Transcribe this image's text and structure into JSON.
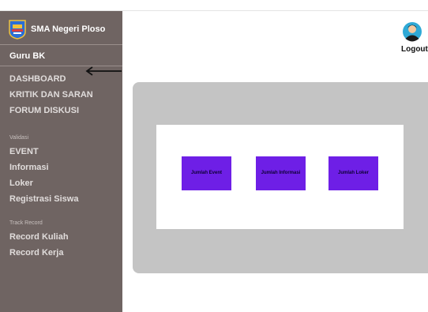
{
  "header": {
    "logout_label": "Logout"
  },
  "sidebar": {
    "school_name": "SMA Negeri Ploso",
    "role": "Guru BK",
    "main_items": [
      {
        "label": "DASHBOARD"
      },
      {
        "label": "KRITIK DAN SARAN"
      },
      {
        "label": "FORUM DISKUSI"
      }
    ],
    "validasi_label": "Validasi",
    "validasi_items": [
      {
        "label": "EVENT"
      },
      {
        "label": "Informasi"
      },
      {
        "label": "Loker"
      },
      {
        "label": "Registrasi Siswa"
      }
    ],
    "track_label": "Track Record",
    "track_items": [
      {
        "label": "Record Kuliah"
      },
      {
        "label": "Record Kerja"
      }
    ]
  },
  "dashboard": {
    "cards": [
      {
        "label": "Jumlah Event"
      },
      {
        "label": "Jumlah Informasi"
      },
      {
        "label": "Jumlah Loker"
      }
    ]
  },
  "colors": {
    "sidebar_bg": "#6f6462",
    "card_purple": "#6e1fe6",
    "panel_gray": "#c4c4c4"
  },
  "icons": [
    "school-logo-icon",
    "arrow-left-icon",
    "user-avatar-icon"
  ]
}
